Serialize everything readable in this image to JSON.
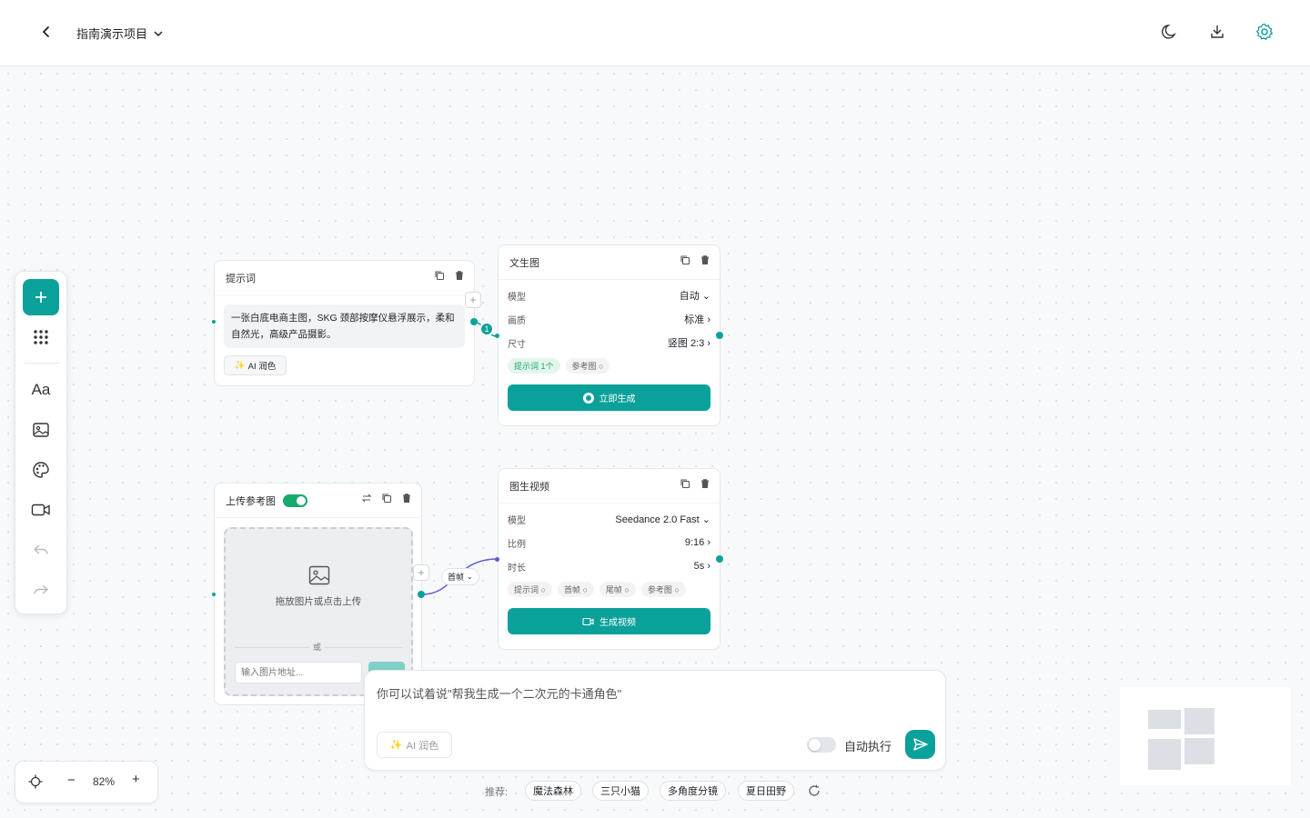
{
  "header": {
    "project": "指南演示项目"
  },
  "toolbar": {
    "items": [
      "add",
      "grid",
      "text",
      "image",
      "palette",
      "video",
      "undo",
      "redo"
    ],
    "text_label": "Aa"
  },
  "prompt_card": {
    "title": "提示词",
    "text": "一张白底电商主图，SKG 颈部按摩仪悬浮展示，柔和自然光，高级产品摄影。",
    "ai_btn": "AI 润色"
  },
  "t2i_card": {
    "title": "文生图",
    "rows": [
      {
        "label": "模型",
        "value": "自动"
      },
      {
        "label": "画质",
        "value": "标准"
      },
      {
        "label": "尺寸",
        "value": "竖图 2:3"
      }
    ],
    "chips": [
      "提示词 1个",
      "参考图"
    ],
    "button": "立即生成",
    "badge": "1"
  },
  "upload_card": {
    "title": "上传参考图",
    "drop_text": "拖放图片或点击上传",
    "or": "或",
    "url_placeholder": "输入图片地址..."
  },
  "edge_label": "首帧",
  "i2v_card": {
    "title": "图生视频",
    "rows": [
      {
        "label": "模型",
        "value": "Seedance 2.0 Fast"
      },
      {
        "label": "比例",
        "value": "9:16"
      },
      {
        "label": "时长",
        "value": "5s"
      }
    ],
    "chips": [
      "提示词",
      "首帧",
      "尾帧",
      "参考图"
    ],
    "button": "生成视频"
  },
  "chat": {
    "placeholder": "你可以试着说\"帮我生成一个二次元的卡通角色\"",
    "ai_btn": "AI 润色",
    "auto_label": "自动执行"
  },
  "recommend": {
    "label": "推荐:",
    "items": [
      "魔法森林",
      "三只小猫",
      "多角度分镜",
      "夏日田野"
    ]
  },
  "zoom": {
    "value": "82%"
  },
  "colors": {
    "accent": "#0aa19a",
    "toggle_on": "#17a86b"
  }
}
